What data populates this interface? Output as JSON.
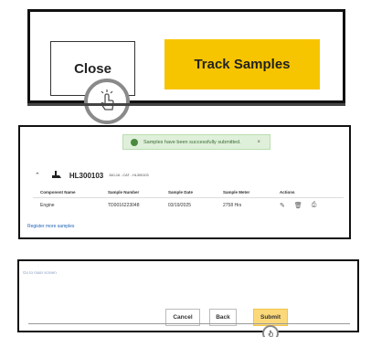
{
  "panel1": {
    "close_label": "Close",
    "track_label": "Track Samples",
    "pointer_icon": "tap-hand-icon"
  },
  "panel2": {
    "toast_text": "Samples have been successfully submitted.",
    "toast_close": "×",
    "serial": "HL300103",
    "serial_meta": "340-16 - CAT - HL300103",
    "headers": [
      "Component Name",
      "Sample Number",
      "Sample Date",
      "Sample Meter",
      "Actions"
    ],
    "row": {
      "component": "Engine",
      "sample_number": "TD0016223048",
      "sample_date": "03/19/2025",
      "sample_meter": "2758 Hrs"
    },
    "register_link": "Register more samples"
  },
  "panel3": {
    "back_link": "Go to main screen",
    "cancel_label": "Cancel",
    "back_label": "Back",
    "submit_label": "Submit"
  },
  "colors": {
    "accent": "#f7c400",
    "toast_bg": "#dff0da",
    "link": "#1f64b5"
  }
}
